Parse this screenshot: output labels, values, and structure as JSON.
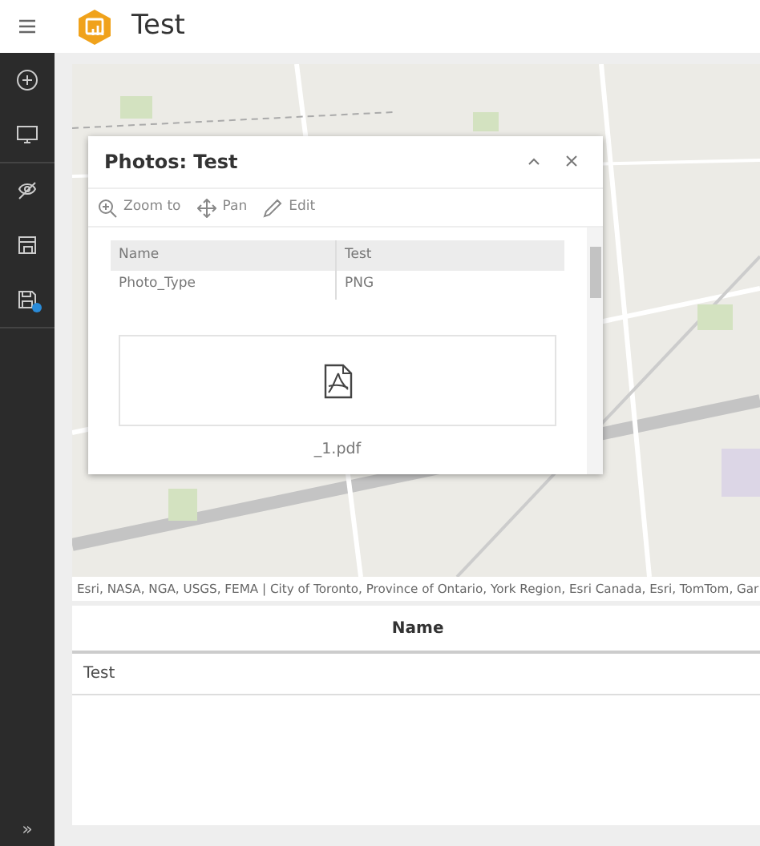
{
  "header": {
    "title": "Test"
  },
  "sidebar": {
    "items": [
      {
        "kind": "add",
        "notification": false
      },
      {
        "kind": "display",
        "notification": false
      },
      {
        "kind": "layers",
        "notification": false
      },
      {
        "kind": "print",
        "notification": false
      },
      {
        "kind": "save",
        "notification": true
      }
    ],
    "collapse": "»"
  },
  "map": {
    "kind": "picture",
    "attribution": "Esri, NASA, NGA, USGS, FEMA | City of Toronto, Province of Ontario, York Region, Esri Canada, Esri, TomTom, Gar"
  },
  "popup": {
    "title": "Photos: Test",
    "actions": [
      {
        "kind": "zoom",
        "label": "Zoom to"
      },
      {
        "kind": "pan",
        "label": "Pan"
      },
      {
        "kind": "edit",
        "label": "Edit"
      }
    ],
    "fields": [
      {
        "name": "Name",
        "value": "Test"
      },
      {
        "name": "Photo_Type",
        "value": "PNG"
      }
    ],
    "attachment": {
      "kind": "pdf",
      "name": "_1.pdf"
    }
  },
  "table": {
    "columns": [
      "Name"
    ],
    "rows": [
      [
        "Test"
      ]
    ]
  }
}
